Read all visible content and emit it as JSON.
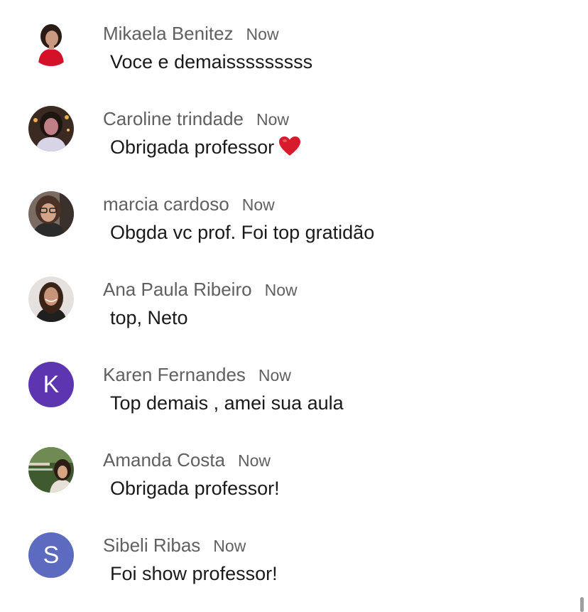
{
  "comments": [
    {
      "name": "Mikaela Benitez",
      "time": "Now",
      "message": "Voce e demaisssssssss",
      "avatar": "photo-red-shirt"
    },
    {
      "name": "Caroline trindade",
      "time": "Now",
      "message": "Obrigada professor",
      "emoji": "heart-emoji",
      "avatar": "photo-night"
    },
    {
      "name": "marcia cardoso",
      "time": "Now",
      "message": "Obgda vc prof. Foi top gratidão",
      "avatar": "photo-glasses"
    },
    {
      "name": "Ana Paula Ribeiro",
      "time": "Now",
      "message": "top, Neto",
      "avatar": "photo-portrait"
    },
    {
      "name": "Karen Fernandes",
      "time": "Now",
      "message": "Top demais , amei sua aula",
      "avatar_initial": "K",
      "avatar_color": "#5e35b1"
    },
    {
      "name": "Amanda Costa",
      "time": "Now",
      "message": "Obrigada professor!",
      "avatar": "photo-outdoor"
    },
    {
      "name": "Sibeli Ribas",
      "time": "Now",
      "message": "Foi show professor!",
      "avatar_initial": "S",
      "avatar_color": "#5c6bc0"
    }
  ],
  "colors": {
    "name_text": "#606060",
    "message_text": "#1a1a1a",
    "heart": "#d81b2c"
  }
}
